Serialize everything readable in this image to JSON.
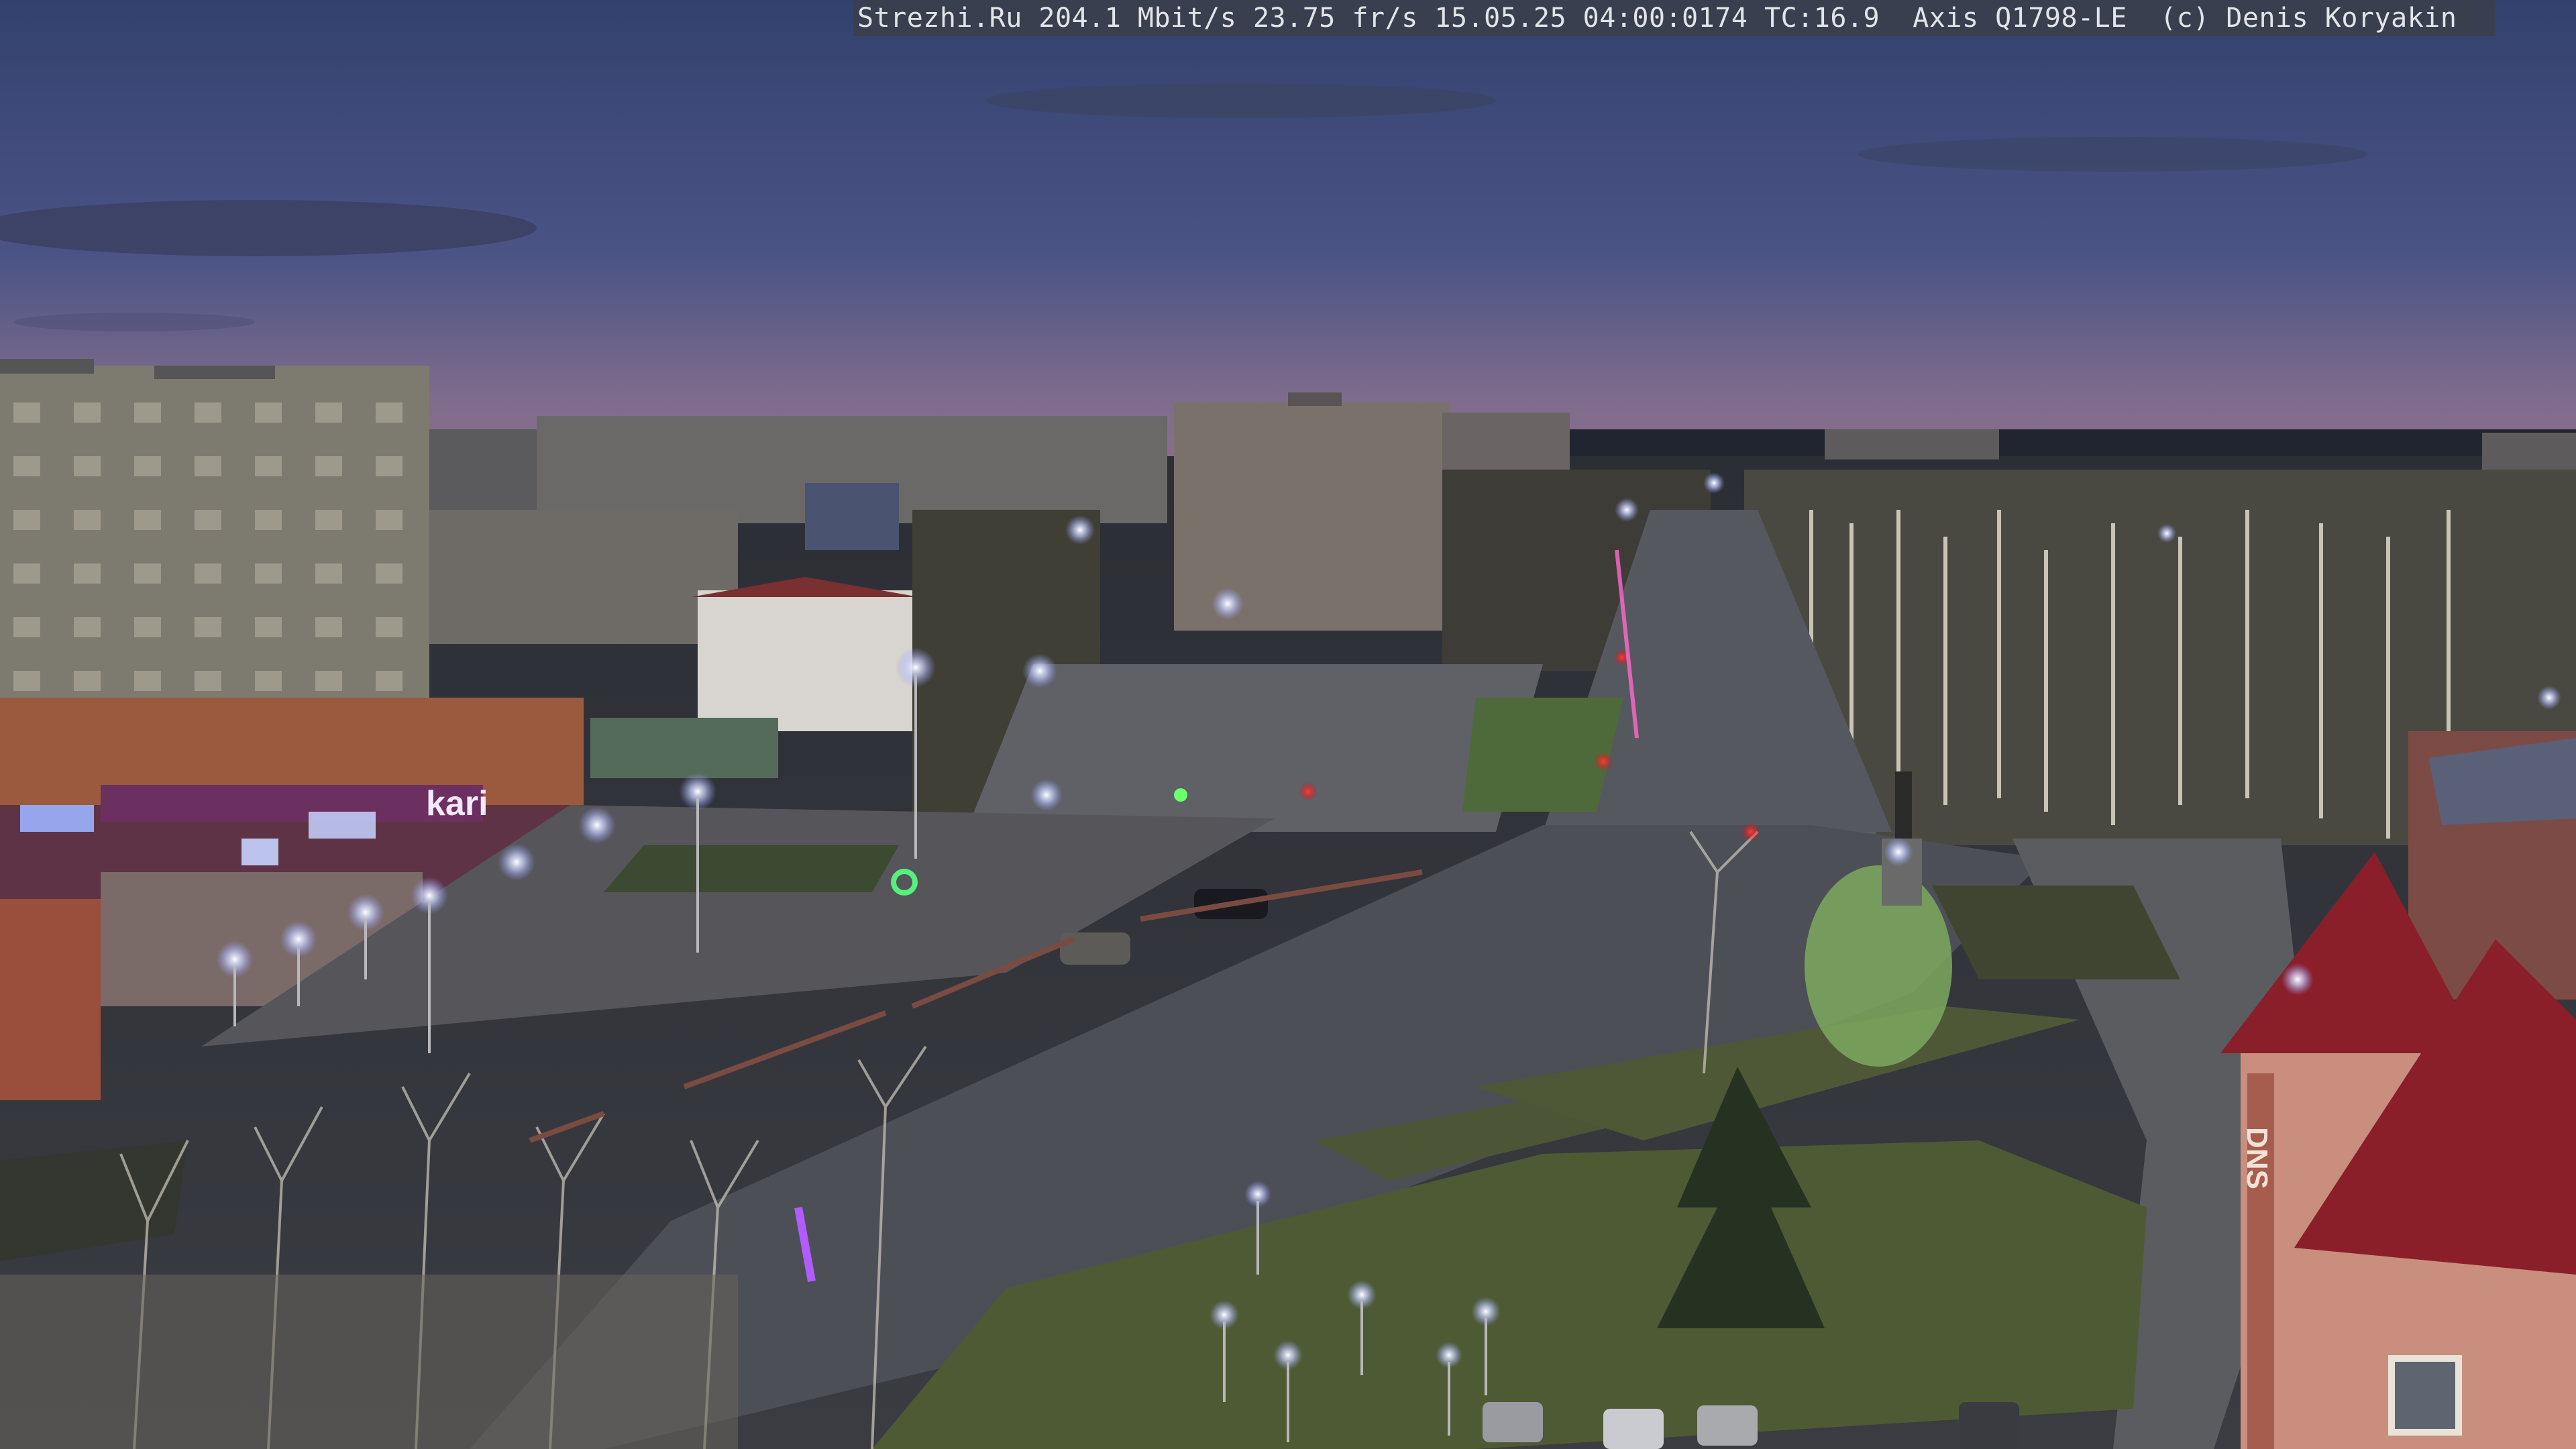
{
  "overlay": {
    "text": "Strezhi.Ru 204.1 Mbit/s 23.75 fr/s 15.05.25 04:00:0174 TC:16.9  Axis Q1798-LE  (c) Denis Koryakin"
  },
  "signage": {
    "storefront_logo": "kari",
    "mall_logo": "DNS"
  },
  "colors": {
    "sky_top": "#3c4a78",
    "sky_horizon": "#7a6b8a",
    "road": "#4a4d55",
    "lawn": "#4d5a34",
    "streetlight": "#e8ecff",
    "traffic_red": "#ff2a2a",
    "brick": "#8a4a3a",
    "mall_roof": "#8a1f2a"
  }
}
